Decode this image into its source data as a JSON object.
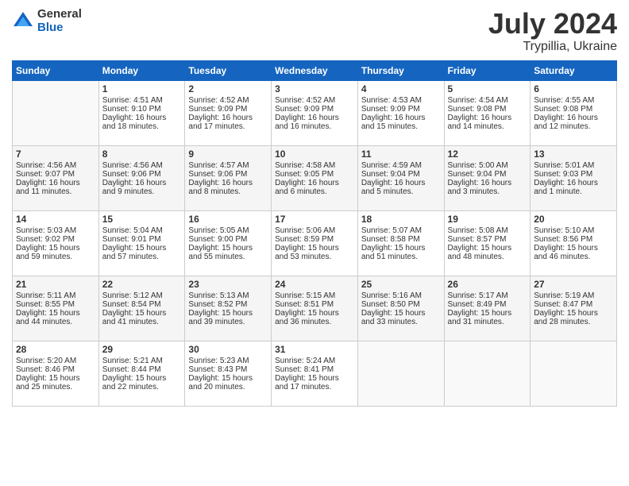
{
  "header": {
    "logo_general": "General",
    "logo_blue": "Blue",
    "month_year": "July 2024",
    "location": "Trypillia, Ukraine"
  },
  "weekdays": [
    "Sunday",
    "Monday",
    "Tuesday",
    "Wednesday",
    "Thursday",
    "Friday",
    "Saturday"
  ],
  "weeks": [
    [
      {
        "day": "",
        "content": ""
      },
      {
        "day": "1",
        "content": "Sunrise: 4:51 AM\nSunset: 9:10 PM\nDaylight: 16 hours\nand 18 minutes."
      },
      {
        "day": "2",
        "content": "Sunrise: 4:52 AM\nSunset: 9:09 PM\nDaylight: 16 hours\nand 17 minutes."
      },
      {
        "day": "3",
        "content": "Sunrise: 4:52 AM\nSunset: 9:09 PM\nDaylight: 16 hours\nand 16 minutes."
      },
      {
        "day": "4",
        "content": "Sunrise: 4:53 AM\nSunset: 9:09 PM\nDaylight: 16 hours\nand 15 minutes."
      },
      {
        "day": "5",
        "content": "Sunrise: 4:54 AM\nSunset: 9:08 PM\nDaylight: 16 hours\nand 14 minutes."
      },
      {
        "day": "6",
        "content": "Sunrise: 4:55 AM\nSunset: 9:08 PM\nDaylight: 16 hours\nand 12 minutes."
      }
    ],
    [
      {
        "day": "7",
        "content": "Sunrise: 4:56 AM\nSunset: 9:07 PM\nDaylight: 16 hours\nand 11 minutes."
      },
      {
        "day": "8",
        "content": "Sunrise: 4:56 AM\nSunset: 9:06 PM\nDaylight: 16 hours\nand 9 minutes."
      },
      {
        "day": "9",
        "content": "Sunrise: 4:57 AM\nSunset: 9:06 PM\nDaylight: 16 hours\nand 8 minutes."
      },
      {
        "day": "10",
        "content": "Sunrise: 4:58 AM\nSunset: 9:05 PM\nDaylight: 16 hours\nand 6 minutes."
      },
      {
        "day": "11",
        "content": "Sunrise: 4:59 AM\nSunset: 9:04 PM\nDaylight: 16 hours\nand 5 minutes."
      },
      {
        "day": "12",
        "content": "Sunrise: 5:00 AM\nSunset: 9:04 PM\nDaylight: 16 hours\nand 3 minutes."
      },
      {
        "day": "13",
        "content": "Sunrise: 5:01 AM\nSunset: 9:03 PM\nDaylight: 16 hours\nand 1 minute."
      }
    ],
    [
      {
        "day": "14",
        "content": "Sunrise: 5:03 AM\nSunset: 9:02 PM\nDaylight: 15 hours\nand 59 minutes."
      },
      {
        "day": "15",
        "content": "Sunrise: 5:04 AM\nSunset: 9:01 PM\nDaylight: 15 hours\nand 57 minutes."
      },
      {
        "day": "16",
        "content": "Sunrise: 5:05 AM\nSunset: 9:00 PM\nDaylight: 15 hours\nand 55 minutes."
      },
      {
        "day": "17",
        "content": "Sunrise: 5:06 AM\nSunset: 8:59 PM\nDaylight: 15 hours\nand 53 minutes."
      },
      {
        "day": "18",
        "content": "Sunrise: 5:07 AM\nSunset: 8:58 PM\nDaylight: 15 hours\nand 51 minutes."
      },
      {
        "day": "19",
        "content": "Sunrise: 5:08 AM\nSunset: 8:57 PM\nDaylight: 15 hours\nand 48 minutes."
      },
      {
        "day": "20",
        "content": "Sunrise: 5:10 AM\nSunset: 8:56 PM\nDaylight: 15 hours\nand 46 minutes."
      }
    ],
    [
      {
        "day": "21",
        "content": "Sunrise: 5:11 AM\nSunset: 8:55 PM\nDaylight: 15 hours\nand 44 minutes."
      },
      {
        "day": "22",
        "content": "Sunrise: 5:12 AM\nSunset: 8:54 PM\nDaylight: 15 hours\nand 41 minutes."
      },
      {
        "day": "23",
        "content": "Sunrise: 5:13 AM\nSunset: 8:52 PM\nDaylight: 15 hours\nand 39 minutes."
      },
      {
        "day": "24",
        "content": "Sunrise: 5:15 AM\nSunset: 8:51 PM\nDaylight: 15 hours\nand 36 minutes."
      },
      {
        "day": "25",
        "content": "Sunrise: 5:16 AM\nSunset: 8:50 PM\nDaylight: 15 hours\nand 33 minutes."
      },
      {
        "day": "26",
        "content": "Sunrise: 5:17 AM\nSunset: 8:49 PM\nDaylight: 15 hours\nand 31 minutes."
      },
      {
        "day": "27",
        "content": "Sunrise: 5:19 AM\nSunset: 8:47 PM\nDaylight: 15 hours\nand 28 minutes."
      }
    ],
    [
      {
        "day": "28",
        "content": "Sunrise: 5:20 AM\nSunset: 8:46 PM\nDaylight: 15 hours\nand 25 minutes."
      },
      {
        "day": "29",
        "content": "Sunrise: 5:21 AM\nSunset: 8:44 PM\nDaylight: 15 hours\nand 22 minutes."
      },
      {
        "day": "30",
        "content": "Sunrise: 5:23 AM\nSunset: 8:43 PM\nDaylight: 15 hours\nand 20 minutes."
      },
      {
        "day": "31",
        "content": "Sunrise: 5:24 AM\nSunset: 8:41 PM\nDaylight: 15 hours\nand 17 minutes."
      },
      {
        "day": "",
        "content": ""
      },
      {
        "day": "",
        "content": ""
      },
      {
        "day": "",
        "content": ""
      }
    ]
  ]
}
